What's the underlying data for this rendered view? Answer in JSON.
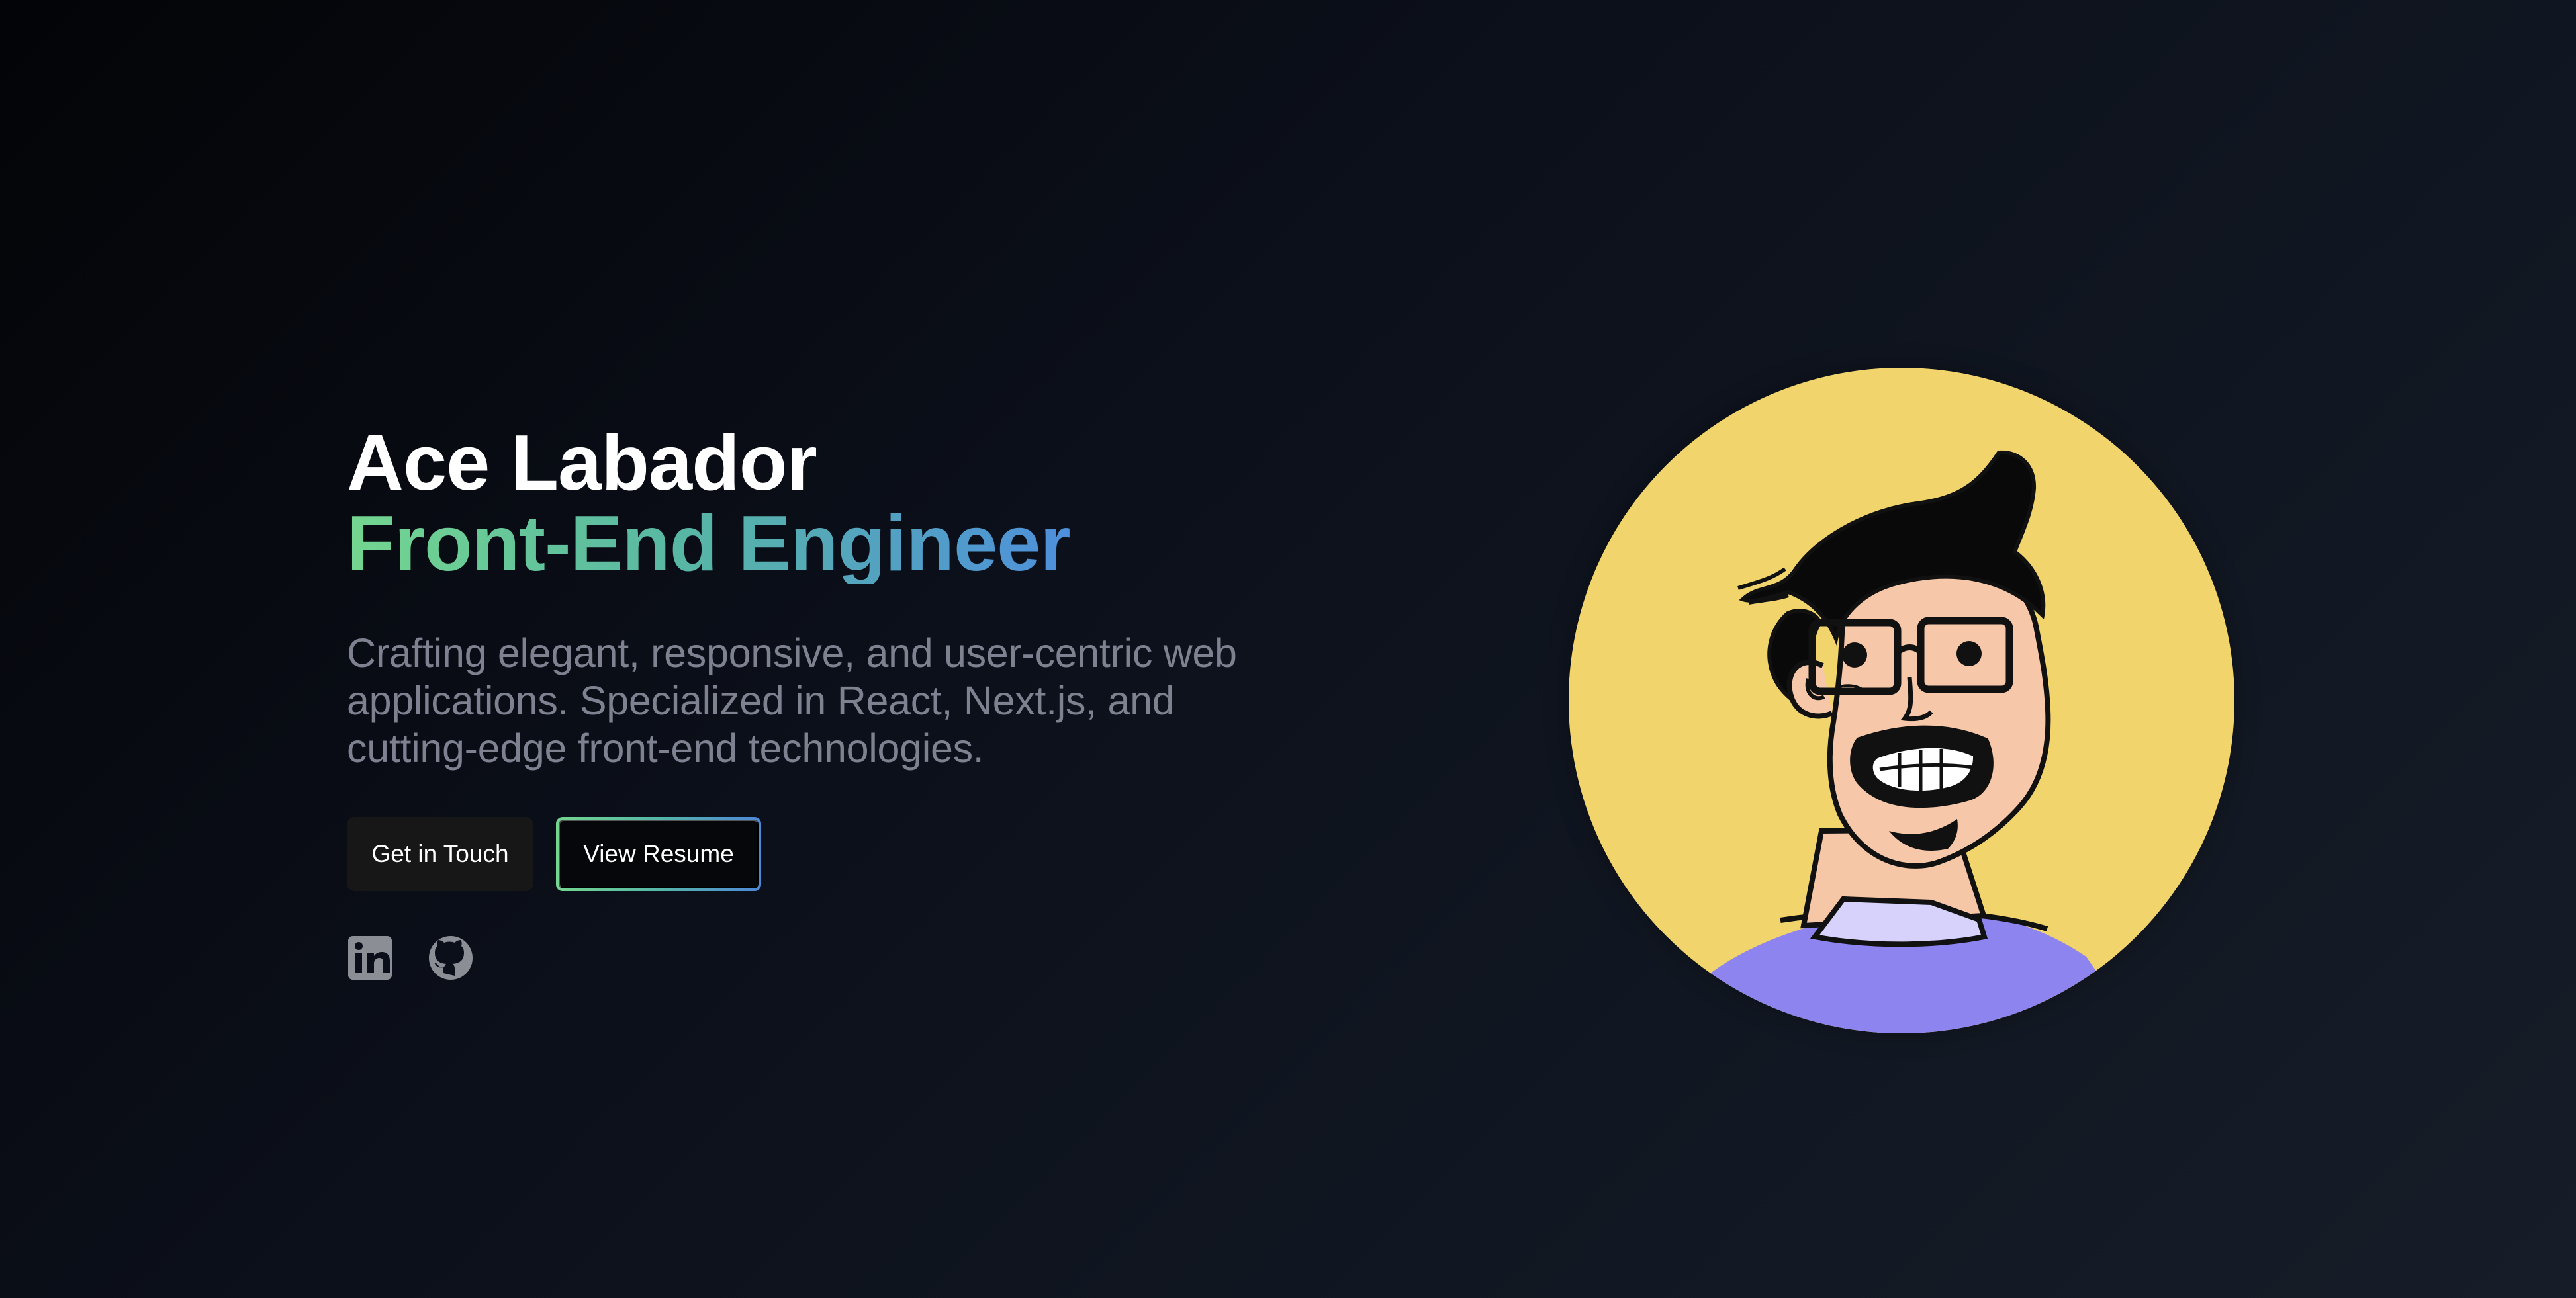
{
  "hero": {
    "name": "Ace Labador",
    "title": "Front-End Engineer",
    "description": "Crafting elegant, responsive, and user-centric web applications. Specialized in React, Next.js, and cutting-edge front-end technologies.",
    "primary_button_label": "Get in Touch",
    "secondary_button_label": "View Resume"
  },
  "social": {
    "items": [
      {
        "icon": "linkedin-icon"
      },
      {
        "icon": "github-icon"
      }
    ]
  },
  "colors": {
    "background": "#0b0f19",
    "gradient_start": "#74d68f",
    "gradient_end": "#4e8fdc",
    "text_muted": "#7d8190",
    "avatar_background": "#f1d46b",
    "shirt": "#8e84f0"
  }
}
